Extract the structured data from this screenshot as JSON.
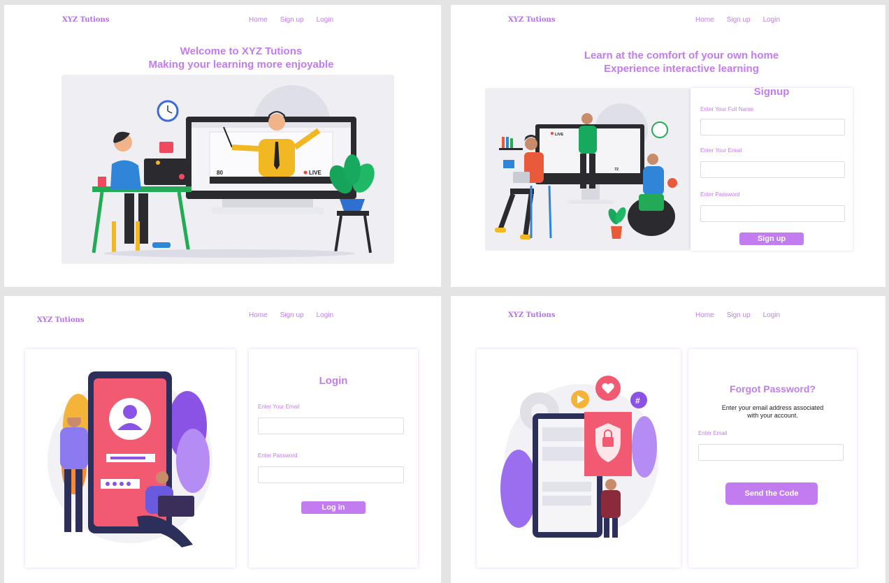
{
  "brand": "XYZ Tutions",
  "nav": {
    "home": "Home",
    "signup": "Sign up",
    "login": "Login"
  },
  "home": {
    "headline1": "Welcome to XYZ Tutions",
    "headline2": "Making your learning more enjoyable",
    "viewers": "80",
    "live": "LIVE"
  },
  "signup": {
    "headline1": "Learn at the comfort of your own home",
    "headline2": "Experience interactive learning",
    "title": "Signup",
    "name_label": "Enter Your  Full Name",
    "email_label": "Enter Your  Email",
    "password_label": "Enter Password",
    "button": "Sign up",
    "live": "LIVE",
    "viewers": "72"
  },
  "login": {
    "title": "Login",
    "email_label": "Enter Your  Email",
    "password_label": "Enter Password",
    "button": "Log in"
  },
  "forgot": {
    "title": "Forgot Password?",
    "desc1": "Enter your email address associated",
    "desc2": "with your account.",
    "email_label": "Enter  Email",
    "button": "Send the Code"
  },
  "colors": {
    "accent": "#c27cf0",
    "brand": "#b46ee8"
  }
}
